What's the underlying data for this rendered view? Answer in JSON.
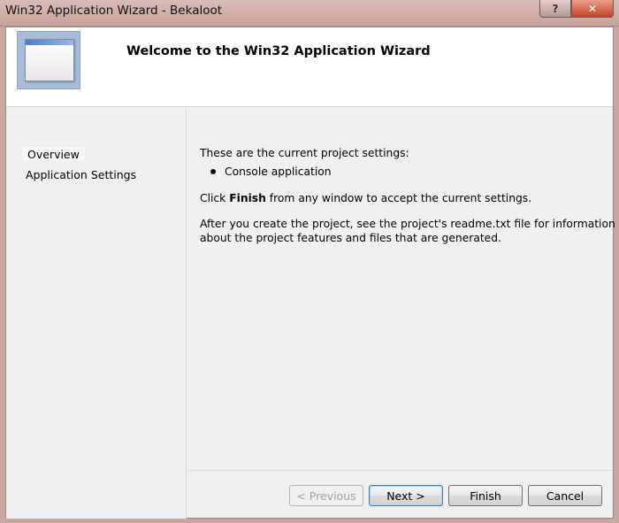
{
  "window": {
    "title": "Win32 Application Wizard - Bekaloot",
    "help_label": "?",
    "close_label": "✕"
  },
  "header": {
    "heading": "Welcome to the Win32 Application Wizard"
  },
  "sidebar": {
    "items": [
      {
        "label": "Overview",
        "active": true
      },
      {
        "label": "Application Settings",
        "active": false
      }
    ]
  },
  "content": {
    "intro": "These are the current project settings:",
    "bullet": "Console application",
    "finish_pre": "Click ",
    "finish_bold": "Finish",
    "finish_post": " from any window to accept the current settings.",
    "readme_line1": "After you create the project, see the project's readme.txt file for information",
    "readme_line2": "about the project features and files that are generated."
  },
  "buttons": {
    "previous": "< Previous",
    "next": "Next >",
    "finish": "Finish",
    "cancel": "Cancel"
  },
  "icons": {
    "logo": "application-window-icon",
    "help": "help-icon",
    "close": "close-icon"
  }
}
